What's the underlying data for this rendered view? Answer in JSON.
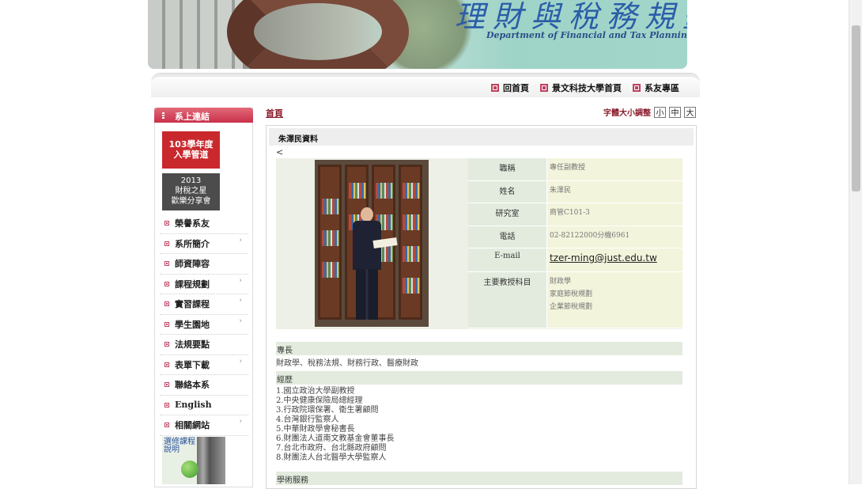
{
  "banner": {
    "title_cn": "理財與稅務規劃系",
    "title_en": "Department of Financial and Tax Planning"
  },
  "topnav": [
    {
      "label": "回首頁"
    },
    {
      "label": "景文科技大學首頁"
    },
    {
      "label": "系友專區"
    }
  ],
  "sidebar": {
    "heading": "系上連結",
    "promo1": {
      "line1": "103學年度",
      "line2": "入學管道"
    },
    "promo2": {
      "line1": "2013",
      "line2": "財稅之星",
      "line3": "歡樂分享會"
    },
    "menu": [
      {
        "label": "榮譽系友",
        "has_sub": false
      },
      {
        "label": "系所簡介",
        "has_sub": true
      },
      {
        "label": "師資陣容",
        "has_sub": false
      },
      {
        "label": "課程規劃",
        "has_sub": true
      },
      {
        "label": "實習課程",
        "has_sub": true
      },
      {
        "label": "學生園地",
        "has_sub": true
      },
      {
        "label": "法規要點",
        "has_sub": false
      },
      {
        "label": "表單下載",
        "has_sub": true
      },
      {
        "label": "聯絡本系",
        "has_sub": false
      },
      {
        "label": "English",
        "has_sub": false
      },
      {
        "label": "相關網站",
        "has_sub": true
      }
    ],
    "promo3": {
      "text": "選修課程說明"
    },
    "chevron": "›"
  },
  "main": {
    "breadcrumb": "首頁",
    "font_size_label": "字體大小調整",
    "font_sizes": [
      "小",
      "中",
      "大"
    ],
    "panel_title": "朱澤民資料",
    "back": "<",
    "profile": [
      {
        "label": "職稱",
        "value": "專任副教授"
      },
      {
        "label": "姓名",
        "value": "朱澤民"
      },
      {
        "label": "研究室",
        "value": "商管C101-3"
      },
      {
        "label": "電話",
        "value": "02-82122000分機6961"
      },
      {
        "label": "E-mail",
        "value": "tzer-ming@just.edu.tw"
      },
      {
        "label": "主要教授科目",
        "value": [
          "財政學",
          "家庭節稅規劃",
          "企業節稅規劃"
        ]
      }
    ],
    "specialty_title": "專長",
    "specialty_text": "財政學、稅務法規、財務行政、醫療財政",
    "experience_title": "經歷",
    "experience": [
      "1.國立政治大學副教授",
      "2.中央健康保險局總經理",
      "3.行政院環保署、衛生署顧問",
      "4.台灣銀行監察人",
      "5.中華財政學會秘書長",
      "6.財團法人道南文教基金會董事長",
      "7.台北市政府、台北縣政府顧問",
      "8.財團法人台北醫學大學監察人"
    ],
    "service_title": "學術服務"
  },
  "colors": {
    "accent": "#8b1b2b",
    "sidebar_head": "#c9304a",
    "label_bg": "#e3ebde",
    "value_bg": "#f3f4dc"
  }
}
